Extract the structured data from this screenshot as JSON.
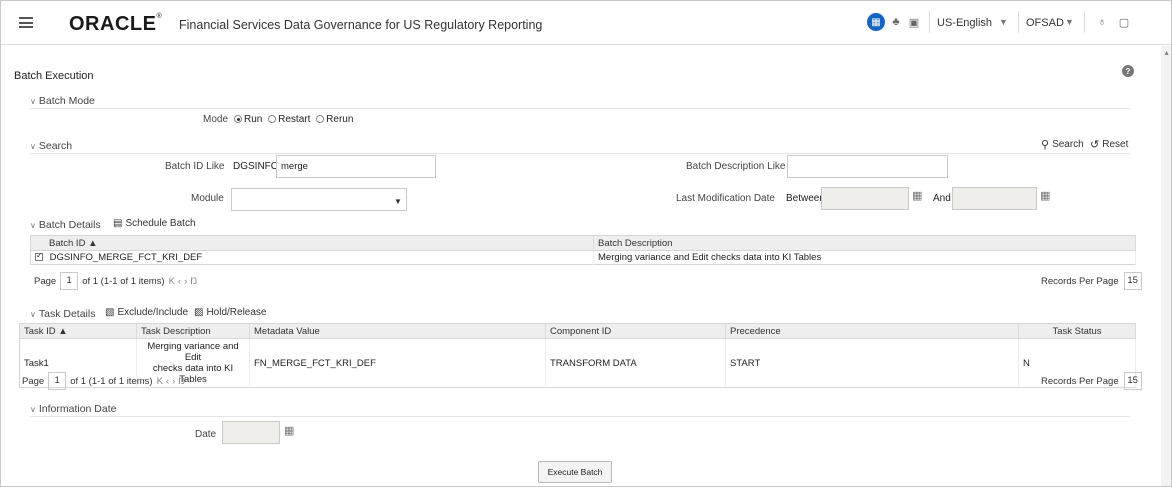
{
  "header": {
    "logo": "ORACLE",
    "logo_mark": "®",
    "app_title": "Financial Services Data Governance for US Regulatory Reporting",
    "language": "US-English",
    "user": "OFSAD"
  },
  "page": {
    "title": "Batch Execution",
    "help_label": "?"
  },
  "batch_mode": {
    "section_label": "Batch Mode",
    "mode_label": "Mode",
    "options": [
      "Run",
      "Restart",
      "Rerun"
    ],
    "selected": "Run"
  },
  "search": {
    "section_label": "Search",
    "search_button": "Search",
    "reset_button": "Reset",
    "batch_id_label": "Batch ID Like",
    "batch_id_prefix": "DGSINFO_",
    "batch_id_value": "merge",
    "batch_desc_label": "Batch Description Like",
    "batch_desc_value": "",
    "module_label": "Module",
    "module_value": "",
    "last_mod_label": "Last Modification Date",
    "between_label": "Between",
    "and_label": "And"
  },
  "batch_details": {
    "section_label": "Batch Details",
    "schedule_button": "Schedule Batch",
    "columns": [
      "Batch ID ▲",
      "Batch Description"
    ],
    "rows": [
      {
        "batch_id": "DGSINFO_MERGE_FCT_KRI_DEF",
        "description": "Merging variance and Edit checks data into KI Tables"
      }
    ],
    "pager_label": "Page",
    "page": "1",
    "page_info": "of 1 (1-1 of 1 items)",
    "records_label": "Records Per Page",
    "records_value": "15"
  },
  "task_details": {
    "section_label": "Task Details",
    "exclude_button": "Exclude/Include",
    "hold_button": "Hold/Release",
    "columns": [
      "Task ID ▲",
      "Task Description",
      "Metadata Value",
      "Component ID",
      "Precedence",
      "Task Status"
    ],
    "rows": [
      {
        "task_id": "Task1",
        "description_line1": "Merging variance and Edit",
        "description_line2": "checks data into KI Tables",
        "metadata": "FN_MERGE_FCT_KRI_DEF",
        "component": "TRANSFORM DATA",
        "precedence": "START",
        "status": "N"
      }
    ],
    "pager_label": "Page",
    "page": "1",
    "page_info": "of 1 (1-1 of 1 items)",
    "records_label": "Records Per Page",
    "records_value": "15"
  },
  "information_date": {
    "section_label": "Information Date",
    "date_label": "Date",
    "date_value": ""
  },
  "footer": {
    "execute_button": "Execute Batch"
  }
}
